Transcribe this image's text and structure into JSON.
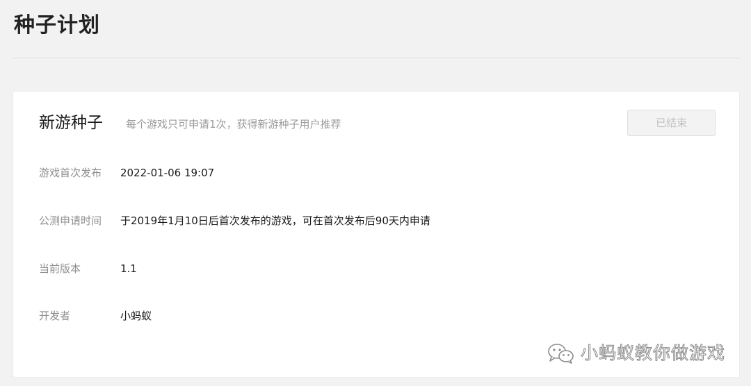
{
  "header": {
    "title": "种子计划"
  },
  "card": {
    "title": "新游种子",
    "subtitle": "每个游戏只可申请1次，获得新游种子用户推荐",
    "status_button": "已结束",
    "rows": [
      {
        "label": "游戏首次发布",
        "value": "2022-01-06 19:07"
      },
      {
        "label": "公测申请时间",
        "value": "于2019年1月10日后首次发布的游戏，可在首次发布后90天内申请"
      },
      {
        "label": "当前版本",
        "value": "1.1"
      },
      {
        "label": "开发者",
        "value": "小蚂蚁"
      }
    ]
  },
  "watermark": {
    "icon": "wechat-icon",
    "text": "小蚂蚁教你做游戏"
  }
}
